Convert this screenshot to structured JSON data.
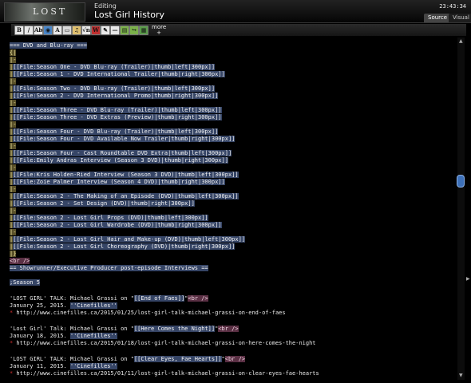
{
  "header": {
    "logo_text": "LOST",
    "mode_label": "Editing",
    "page_title": "Lost Girl History",
    "clock": "23:43:34",
    "tabs": [
      "Source",
      "Visual"
    ]
  },
  "toolbar": {
    "more_label": "more",
    "buttons": [
      {
        "name": "bold-button",
        "glyph": "B",
        "color": "#e8e8e8"
      },
      {
        "name": "italic-button",
        "glyph": "/",
        "color": "#e8e8e8"
      },
      {
        "name": "link-button",
        "glyph": "Ab",
        "color": "#e8e8e8"
      },
      {
        "name": "globe-button",
        "glyph": "◉",
        "color": "#4a86c8"
      },
      {
        "name": "headline-button",
        "glyph": "A",
        "color": "#e8e8e8"
      },
      {
        "name": "image-button",
        "glyph": "▭",
        "color": "#d9d9d9"
      },
      {
        "name": "media-button",
        "glyph": "♫",
        "color": "#e0c070"
      },
      {
        "name": "math-button",
        "glyph": "√n",
        "color": "#e8e8e8"
      },
      {
        "name": "nowiki-button",
        "glyph": "W",
        "color": "#c03030"
      },
      {
        "name": "signature-button",
        "glyph": "✎",
        "color": "#e8e8e8"
      },
      {
        "name": "hr-button",
        "glyph": "—",
        "color": "#e8e8e8"
      },
      {
        "name": "template-button",
        "glyph": "▤",
        "color": "#7ab04a"
      },
      {
        "name": "redirect-button",
        "glyph": "↪",
        "color": "#7ab04a"
      },
      {
        "name": "gallery-button",
        "glyph": "▦",
        "color": "#5a9a4a"
      }
    ]
  },
  "editor": {
    "colors": {
      "highlight": "#364566",
      "highlight_yellow": "#5a5129",
      "highlight_pink": "#5a3044",
      "bullet": "#d02d2d"
    },
    "lines": [
      {
        "segments": [
          {
            "t": "=== DVD and Blu-ray ===",
            "s": "hl"
          }
        ]
      },
      {
        "segments": [
          {
            "t": "{|",
            "s": "hl-y"
          }
        ]
      },
      {
        "segments": [
          {
            "t": "|-",
            "s": "hl-y"
          }
        ]
      },
      {
        "segments": [
          {
            "t": "|",
            "s": "hl-y"
          },
          {
            "t": "[[File:Season One - DVD Blu-ray (Trailer)|thumb|left|300px]]",
            "s": "hl"
          }
        ]
      },
      {
        "segments": [
          {
            "t": "|",
            "s": "hl-y"
          },
          {
            "t": "[[File:Season 1 - DVD International Trailer|thumb|right|300px]]",
            "s": "hl"
          }
        ]
      },
      {
        "segments": [
          {
            "t": "|-",
            "s": "hl-y"
          }
        ]
      },
      {
        "segments": [
          {
            "t": "|",
            "s": "hl-y"
          },
          {
            "t": "[[File:Season Two - DVD Blu-ray (Trailer)|thumb|left|300px]]",
            "s": "hl"
          }
        ]
      },
      {
        "segments": [
          {
            "t": "|",
            "s": "hl-y"
          },
          {
            "t": "[[File:Season 2 - DVD International Promo|thumb|right|300px]]",
            "s": "hl"
          }
        ]
      },
      {
        "segments": [
          {
            "t": "|-",
            "s": "hl-y"
          }
        ]
      },
      {
        "segments": [
          {
            "t": "|",
            "s": "hl-y"
          },
          {
            "t": "[[File:Season Three - DVD Blu-ray (Trailer)|thumb|left|300px]]",
            "s": "hl"
          }
        ]
      },
      {
        "segments": [
          {
            "t": "|",
            "s": "hl-y"
          },
          {
            "t": "[[File:Season Three - DVD Extras (Preview)|thumb|right|300px]]",
            "s": "hl"
          }
        ]
      },
      {
        "segments": [
          {
            "t": "|-",
            "s": "hl-y"
          }
        ]
      },
      {
        "segments": [
          {
            "t": "|",
            "s": "hl-y"
          },
          {
            "t": "[[File:Season Four - DVD Blu-ray (Trailer)|thumb|left|300px]]",
            "s": "hl"
          }
        ]
      },
      {
        "segments": [
          {
            "t": "|",
            "s": "hl-y"
          },
          {
            "t": "[[File:Season Four - DVD Available Now Trailer|thumb|right|300px]]",
            "s": "hl"
          }
        ]
      },
      {
        "segments": [
          {
            "t": "|-",
            "s": "hl-y"
          }
        ]
      },
      {
        "segments": [
          {
            "t": "|",
            "s": "hl-y"
          },
          {
            "t": "[[File:Season Four - Cast Roundtable DVD Extra|thumb|left|300px]]",
            "s": "hl"
          }
        ]
      },
      {
        "segments": [
          {
            "t": "|",
            "s": "hl-y"
          },
          {
            "t": "[[File:Emily Andras Interview (Season 3 DVD)|thumb|right|300px]]",
            "s": "hl"
          }
        ]
      },
      {
        "segments": [
          {
            "t": "|-",
            "s": "hl-y"
          }
        ]
      },
      {
        "segments": [
          {
            "t": "|",
            "s": "hl-y"
          },
          {
            "t": "[[File:Kris Holden-Ried Interview (Season 3 DVD)|thumb|left|300px]]",
            "s": "hl"
          }
        ]
      },
      {
        "segments": [
          {
            "t": "|",
            "s": "hl-y"
          },
          {
            "t": "[[File:Zoie Palmer Interview (Season 4 DVD)|thumb|right|300px]]",
            "s": "hl"
          }
        ]
      },
      {
        "segments": [
          {
            "t": "|-",
            "s": "hl-y"
          }
        ]
      },
      {
        "segments": [
          {
            "t": "|",
            "s": "hl-y"
          },
          {
            "t": "[[File:Season 2 - The Making of an Episode (DVD)|thumb|left|300px]]",
            "s": "hl"
          }
        ]
      },
      {
        "segments": [
          {
            "t": "|",
            "s": "hl-y"
          },
          {
            "t": "[[File:Season 2 - Set Design (DVD)|thumb|right|300px]]",
            "s": "hl"
          }
        ]
      },
      {
        "segments": [
          {
            "t": "|-",
            "s": "hl-y"
          }
        ]
      },
      {
        "segments": [
          {
            "t": "|",
            "s": "hl-y"
          },
          {
            "t": "[[File:Season 2 - Lost Girl Props (DVD)|thumb|left|300px]]",
            "s": "hl"
          }
        ]
      },
      {
        "segments": [
          {
            "t": "|",
            "s": "hl-y"
          },
          {
            "t": "[[File:Season 2 - Lost Girl Wardrobe (DVD)|thumb|right|300px]]",
            "s": "hl"
          }
        ]
      },
      {
        "segments": [
          {
            "t": "|-",
            "s": "hl-y"
          }
        ]
      },
      {
        "segments": [
          {
            "t": "|",
            "s": "hl-y"
          },
          {
            "t": "[[File:Season 2 - Lost Girl Hair and Make-up (DVD)|thumb|left|300px]]",
            "s": "hl"
          }
        ]
      },
      {
        "segments": [
          {
            "t": "|",
            "s": "hl-y"
          },
          {
            "t": "[[File:Season 2 - Lost Girl Choreography (DVD)|thumb|right|300px]]",
            "s": "hl"
          }
        ]
      },
      {
        "segments": [
          {
            "t": "|}",
            "s": "hl-y"
          }
        ]
      },
      {
        "segments": [
          {
            "t": "<br />",
            "s": "hl-p"
          }
        ]
      },
      {
        "segments": [
          {
            "t": "== Showrunner/Executive Producer post-episode Interviews ==",
            "s": "hl"
          }
        ]
      },
      {
        "segments": []
      },
      {
        "segments": [
          {
            "t": ";Season 5",
            "s": "hl"
          }
        ]
      },
      {
        "segments": []
      },
      {
        "segments": [
          {
            "t": "'LOST GIRL' TALK: Michael Grassi on \"",
            "s": ""
          },
          {
            "t": "[[End of Faes]]",
            "s": "hl"
          },
          {
            "t": "\"",
            "s": ""
          },
          {
            "t": "<br />",
            "s": "hl-p"
          }
        ]
      },
      {
        "segments": [
          {
            "t": "January 25, 2015. ",
            "s": ""
          },
          {
            "t": "''Cinefilles''",
            "s": "hl"
          }
        ]
      },
      {
        "segments": [
          {
            "t": "*",
            "s": "red"
          },
          {
            "t": " http://www.cinefilles.ca/2015/01/25/lost-girl-talk-michael-grassi-on-end-of-faes",
            "s": ""
          }
        ]
      },
      {
        "segments": []
      },
      {
        "segments": [
          {
            "t": "'Lost Girl' Talk: Michael Grassi on \"",
            "s": ""
          },
          {
            "t": "[[Here Comes the Night]]",
            "s": "hl"
          },
          {
            "t": "\"",
            "s": ""
          },
          {
            "t": "<br />",
            "s": "hl-p"
          }
        ]
      },
      {
        "segments": [
          {
            "t": "January 18, 2015. ",
            "s": ""
          },
          {
            "t": "''Cinefilles''",
            "s": "hl"
          }
        ]
      },
      {
        "segments": [
          {
            "t": "*",
            "s": "red"
          },
          {
            "t": " http://www.cinefilles.ca/2015/01/18/lost-girl-talk-michael-grassi-on-here-comes-the-night",
            "s": ""
          }
        ]
      },
      {
        "segments": []
      },
      {
        "segments": [
          {
            "t": "'LOST GIRL' TALK: Michael Grassi on \"",
            "s": ""
          },
          {
            "t": "[[Clear Eyes, Fae Hearts]]",
            "s": "hl"
          },
          {
            "t": "\"",
            "s": ""
          },
          {
            "t": "<br />",
            "s": "hl-p"
          }
        ]
      },
      {
        "segments": [
          {
            "t": "January 11, 2015. ",
            "s": ""
          },
          {
            "t": "''Cinefilles''",
            "s": "hl"
          }
        ]
      },
      {
        "segments": [
          {
            "t": "*",
            "s": "red"
          },
          {
            "t": " http://www.cinefilles.ca/2015/01/11/lost-girl-talk-michael-grassi-on-clear-eyes-fae-hearts",
            "s": ""
          }
        ]
      }
    ]
  },
  "scrollbar": {
    "position_fraction": 0.41
  }
}
